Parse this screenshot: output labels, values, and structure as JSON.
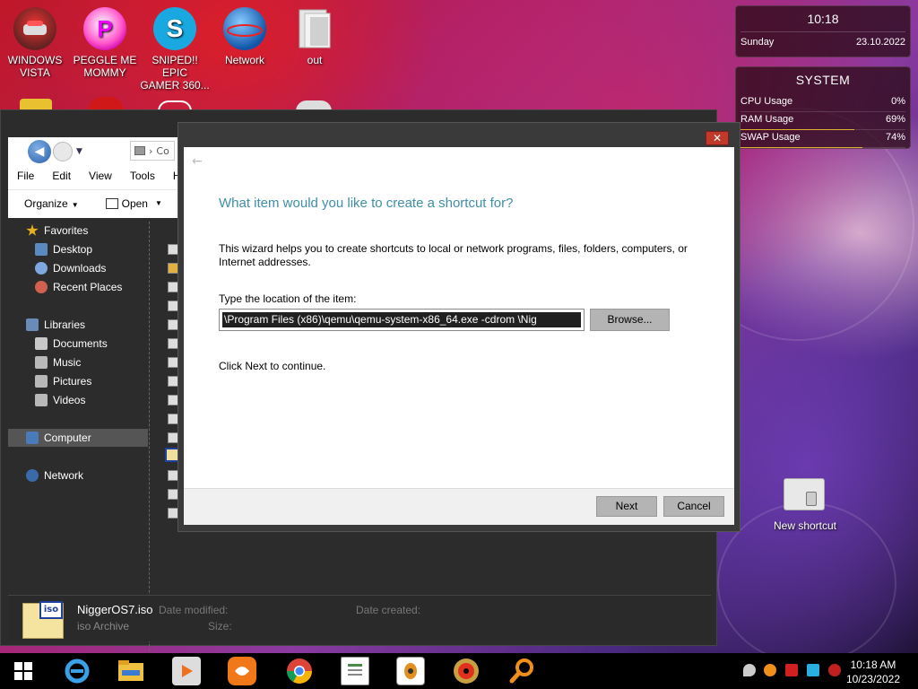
{
  "desktop": {
    "icons": [
      {
        "label_line1": "WINDOWS",
        "label_line2": "VISTA",
        "icon": "windows-vista-icon"
      },
      {
        "label_line1": "PEGGLE ME",
        "label_line2": "MOMMY",
        "icon": "peggle-icon"
      },
      {
        "label_line1": "SNIPED!! EPIC",
        "label_line2": "GAMER 360...",
        "icon": "skype-icon"
      },
      {
        "label_line1": "Network",
        "label_line2": "",
        "icon": "network-icon"
      },
      {
        "label_line1": "out",
        "label_line2": "",
        "icon": "folder-icon"
      }
    ],
    "shortcut": {
      "label": "New shortcut",
      "icon": "shortcut-icon"
    }
  },
  "gadgets": {
    "clock": {
      "time": "10:18",
      "day": "Sunday",
      "date": "23.10.2022"
    },
    "system": {
      "title": "SYSTEM",
      "rows": [
        {
          "label": "CPU Usage",
          "value": "0%",
          "percent": 0
        },
        {
          "label": "RAM Usage",
          "value": "69%",
          "percent": 69
        },
        {
          "label": "SWAP Usage",
          "value": "74%",
          "percent": 74
        }
      ]
    }
  },
  "explorer": {
    "address_prefix": "Co",
    "menu": [
      "File",
      "Edit",
      "View",
      "Tools",
      "Help"
    ],
    "toolbar": {
      "organize": "Organize",
      "open": "Open"
    },
    "sidebar": {
      "favorites": "Favorites",
      "desktop": "Desktop",
      "downloads": "Downloads",
      "recent": "Recent Places",
      "libraries": "Libraries",
      "documents": "Documents",
      "music": "Music",
      "pictures": "Pictures",
      "videos": "Videos",
      "computer": "Computer",
      "network": "Network"
    },
    "details": {
      "name": "NiggerOS7.iso",
      "type": "iso Archive",
      "icon_tag": "iso",
      "modified_label": "Date modified:",
      "created_label": "Date created:",
      "size_label": "Size:"
    }
  },
  "wizard": {
    "back_glyph": "←",
    "close_glyph": "✕",
    "heading": "What item would you like to create a shortcut for?",
    "description": "This wizard helps you to create shortcuts to local or network programs, files, folders, computers, or Internet addresses.",
    "location_label": "Type the location of the item:",
    "location_value": "\\Program Files (x86)\\qemu\\qemu-system-x86_64.exe -cdrom \\Nig",
    "browse": "Browse...",
    "continue_text": "Click Next to continue.",
    "next": "Next",
    "cancel": "Cancel"
  },
  "taskbar": {
    "time": "10:18 AM",
    "date": "10/23/2022",
    "apps": [
      "internet-explorer-icon",
      "file-explorer-icon",
      "media-player-icon",
      "uc-browser-icon",
      "chrome-icon",
      "notepad-icon",
      "game-icon",
      "disc-icon",
      "search-icon"
    ]
  }
}
